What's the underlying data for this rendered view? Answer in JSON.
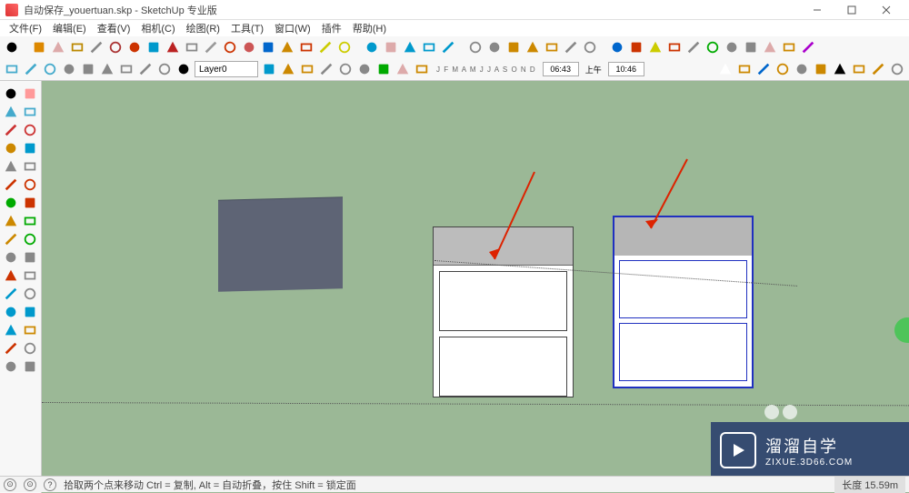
{
  "window": {
    "title": "自动保存_youertuan.skp - SketchUp 专业版"
  },
  "menu": {
    "items": [
      "文件(F)",
      "编辑(E)",
      "查看(V)",
      "相机(C)",
      "绘图(R)",
      "工具(T)",
      "窗口(W)",
      "插件",
      "帮助(H)"
    ]
  },
  "toolbar2": {
    "layer": "Layer0",
    "time1": "06:43",
    "ampm": "上午",
    "time2": "10:46",
    "letters": "J F M A M J J A S O N D"
  },
  "status": {
    "hint": "拾取两个点来移动 Ctrl = 复制, Alt = 自动折叠，按住 Shift = 锁定面",
    "right_label": "长度",
    "right_value": "15.59m"
  },
  "watermark": {
    "big": "溜溜自学",
    "small": "ZIXUE.3D66.COM"
  },
  "icons": {
    "row1": [
      {
        "n": "select-arrow",
        "c": "#000"
      },
      {
        "n": "pencil",
        "c": "#d80"
      },
      {
        "n": "rect",
        "c": "#daa"
      },
      {
        "n": "circle",
        "c": "#b80"
      },
      {
        "n": "push",
        "c": "#888"
      },
      {
        "n": "paint",
        "c": "#a33"
      },
      {
        "n": "move",
        "c": "#c30"
      },
      {
        "n": "rotate",
        "c": "#09c"
      },
      {
        "n": "scale",
        "c": "#b22"
      },
      {
        "n": "offset",
        "c": "#888"
      },
      {
        "n": "tape",
        "c": "#999"
      },
      {
        "n": "text",
        "c": "#c30"
      },
      {
        "n": "eraser",
        "c": "#c55"
      },
      {
        "n": "axes",
        "c": "#06c"
      },
      {
        "n": "walk",
        "c": "#c80"
      },
      {
        "n": "cam",
        "c": "#c30"
      },
      {
        "n": "undo",
        "c": "#cc0"
      },
      {
        "n": "redo",
        "c": "#cc0"
      },
      {
        "n": "orbit",
        "c": "#09c"
      },
      {
        "n": "pan",
        "c": "#daa"
      },
      {
        "n": "zoom",
        "c": "#09c"
      },
      {
        "n": "zoom-win",
        "c": "#09c"
      },
      {
        "n": "zoom-ext",
        "c": "#09c"
      },
      {
        "n": "prev",
        "c": "#888"
      },
      {
        "n": "iso",
        "c": "#888"
      },
      {
        "n": "wire",
        "c": "#c80"
      },
      {
        "n": "shade",
        "c": "#c80"
      },
      {
        "n": "hair",
        "c": "#c80"
      },
      {
        "n": "xray",
        "c": "#888"
      },
      {
        "n": "mono",
        "c": "#888"
      },
      {
        "n": "plugin1",
        "c": "#06c"
      },
      {
        "n": "plugin2",
        "c": "#c30"
      },
      {
        "n": "m-btn",
        "c": "#cc0"
      },
      {
        "n": "dot-y",
        "c": "#c30"
      },
      {
        "n": "r-btn",
        "c": "#888"
      },
      {
        "n": "dot-t",
        "c": "#0a0"
      },
      {
        "n": "plugin3",
        "c": "#888"
      },
      {
        "n": "plugin4",
        "c": "#888"
      },
      {
        "n": "plugin5",
        "c": "#daa"
      },
      {
        "n": "plugin6",
        "c": "#c80"
      },
      {
        "n": "color-wheel",
        "c": "#a0c"
      }
    ],
    "row2": [
      {
        "n": "component",
        "c": "#4ac"
      },
      {
        "n": "outliner",
        "c": "#4ac"
      },
      {
        "n": "layers",
        "c": "#4ac"
      },
      {
        "n": "box1",
        "c": "#888"
      },
      {
        "n": "box2",
        "c": "#888"
      },
      {
        "n": "box3",
        "c": "#888"
      },
      {
        "n": "box4",
        "c": "#888"
      },
      {
        "n": "stack",
        "c": "#888"
      },
      {
        "n": "menu-drop",
        "c": "#888"
      },
      {
        "n": "check",
        "c": "#000"
      },
      {
        "n": "refresh",
        "c": "#09c"
      },
      {
        "n": "open",
        "c": "#c80"
      },
      {
        "n": "open2",
        "c": "#c80"
      },
      {
        "n": "sect1",
        "c": "#888"
      },
      {
        "n": "sect2",
        "c": "#888"
      },
      {
        "n": "home",
        "c": "#888"
      },
      {
        "n": "tree",
        "c": "#0a0"
      },
      {
        "n": "face",
        "c": "#daa"
      },
      {
        "n": "pencil2",
        "c": "#c80"
      },
      {
        "n": "new",
        "c": "#fff"
      },
      {
        "n": "open3",
        "c": "#c80"
      },
      {
        "n": "save",
        "c": "#06c"
      },
      {
        "n": "cut",
        "c": "#c80"
      },
      {
        "n": "copy",
        "c": "#888"
      },
      {
        "n": "paste",
        "c": "#c80"
      },
      {
        "n": "delete",
        "c": "#000"
      },
      {
        "n": "undo2",
        "c": "#c80"
      },
      {
        "n": "redo2",
        "c": "#c80"
      },
      {
        "n": "print",
        "c": "#888"
      }
    ],
    "left": [
      [
        {
          "n": "select",
          "c": "#000"
        },
        {
          "n": "eraser2",
          "c": "#f99"
        }
      ],
      [
        {
          "n": "cube1",
          "c": "#4ac"
        },
        {
          "n": "cube2",
          "c": "#4ac"
        }
      ],
      [
        {
          "n": "rect2",
          "c": "#c33"
        },
        {
          "n": "line",
          "c": "#c33"
        }
      ],
      [
        {
          "n": "circ",
          "c": "#c80"
        },
        {
          "n": "arc",
          "c": "#09c"
        }
      ],
      [
        {
          "n": "poly",
          "c": "#888"
        },
        {
          "n": "free",
          "c": "#888"
        }
      ],
      [
        {
          "n": "star",
          "c": "#c30"
        },
        {
          "n": "gear",
          "c": "#c30"
        }
      ],
      [
        {
          "n": "arc1",
          "c": "#0a0"
        },
        {
          "n": "arc2",
          "c": "#c30"
        }
      ],
      [
        {
          "n": "push2",
          "c": "#c80"
        },
        {
          "n": "follow",
          "c": "#0a0"
        }
      ],
      [
        {
          "n": "scale2",
          "c": "#c80"
        },
        {
          "n": "off2",
          "c": "#0a0"
        }
      ],
      [
        {
          "n": "grp",
          "c": "#888"
        },
        {
          "n": "comp",
          "c": "#888"
        }
      ],
      [
        {
          "n": "flip",
          "c": "#c30"
        },
        {
          "n": "int",
          "c": "#888"
        }
      ],
      [
        {
          "n": "dim",
          "c": "#09c"
        },
        {
          "n": "txt",
          "c": "#888"
        }
      ],
      [
        {
          "n": "orbit2",
          "c": "#09c"
        },
        {
          "n": "pan2",
          "c": "#09c"
        }
      ],
      [
        {
          "n": "zoom2",
          "c": "#09c"
        },
        {
          "n": "man",
          "c": "#c80"
        }
      ],
      [
        {
          "n": "mat",
          "c": "#c30"
        },
        {
          "n": "stamp",
          "c": "#888"
        }
      ],
      [
        {
          "n": "cube3",
          "c": "#888"
        },
        {
          "n": "cube4",
          "c": "#888"
        }
      ]
    ]
  }
}
